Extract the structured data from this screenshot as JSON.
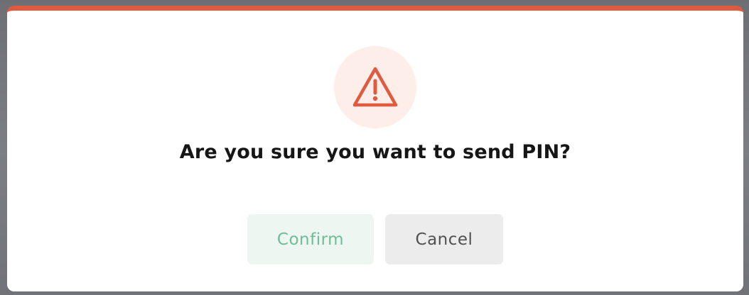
{
  "dialog": {
    "message": "Are you sure you want to send PIN?",
    "icon": "warning-triangle-icon",
    "confirm_label": "Confirm",
    "cancel_label": "Cancel"
  },
  "colors": {
    "accent": "#df5a3e",
    "icon_bg": "#fdeeea",
    "confirm_bg": "#eef6f2",
    "confirm_text": "#6fbd98",
    "cancel_bg": "#ececec",
    "cancel_text": "#505050",
    "backdrop": "#76777d"
  }
}
